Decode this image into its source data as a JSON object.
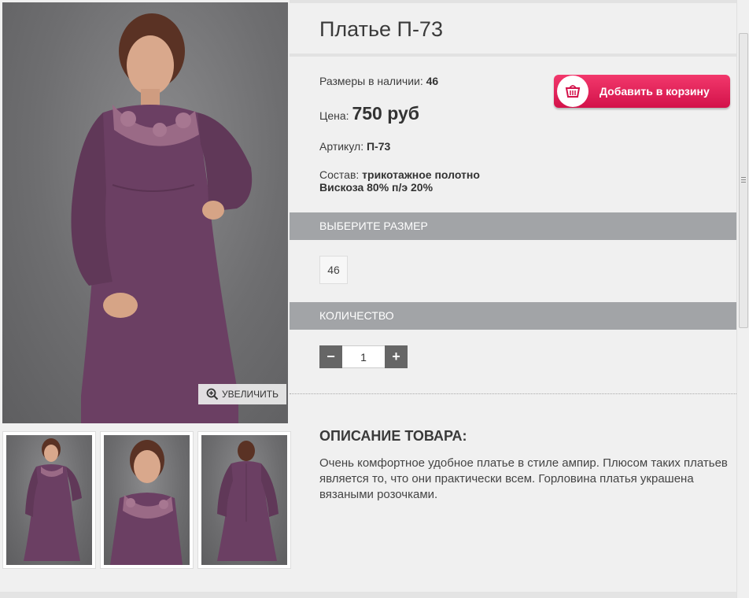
{
  "product": {
    "title": "Платье П-73",
    "sizes_label": "Размеры в наличии:",
    "sizes_value": "46",
    "price_label": "Цена:",
    "price_value": "750 руб",
    "article_label": "Артикул:",
    "article_value": "П-73",
    "composition_label": "Состав:",
    "composition_line1": "трикотажное полотно",
    "composition_line2": "Вискоза 80% п/э 20%"
  },
  "cart": {
    "label": "Добавить в корзину",
    "icon": "basket-icon"
  },
  "zoom": {
    "label": "УВЕЛИЧИТЬ",
    "icon": "zoom-in-icon"
  },
  "size_section": {
    "heading": "ВЫБЕРИТЕ РАЗМЕР",
    "options": [
      "46"
    ]
  },
  "quantity_section": {
    "heading": "КОЛИЧЕСТВО",
    "minus": "−",
    "plus": "+",
    "value": "1"
  },
  "description": {
    "heading": "ОПИСАНИЕ ТОВАРА:",
    "text": "Очень комфортное удобное платье в стиле ампир. Плюсом таких платьев является то, что они практически всем. Горловина платья украшена вязаными розочками."
  },
  "colors": {
    "accent": "#e0245e",
    "section": "#a2a4a7",
    "dress": "#6b3f63",
    "background": "#f0f0f0"
  }
}
